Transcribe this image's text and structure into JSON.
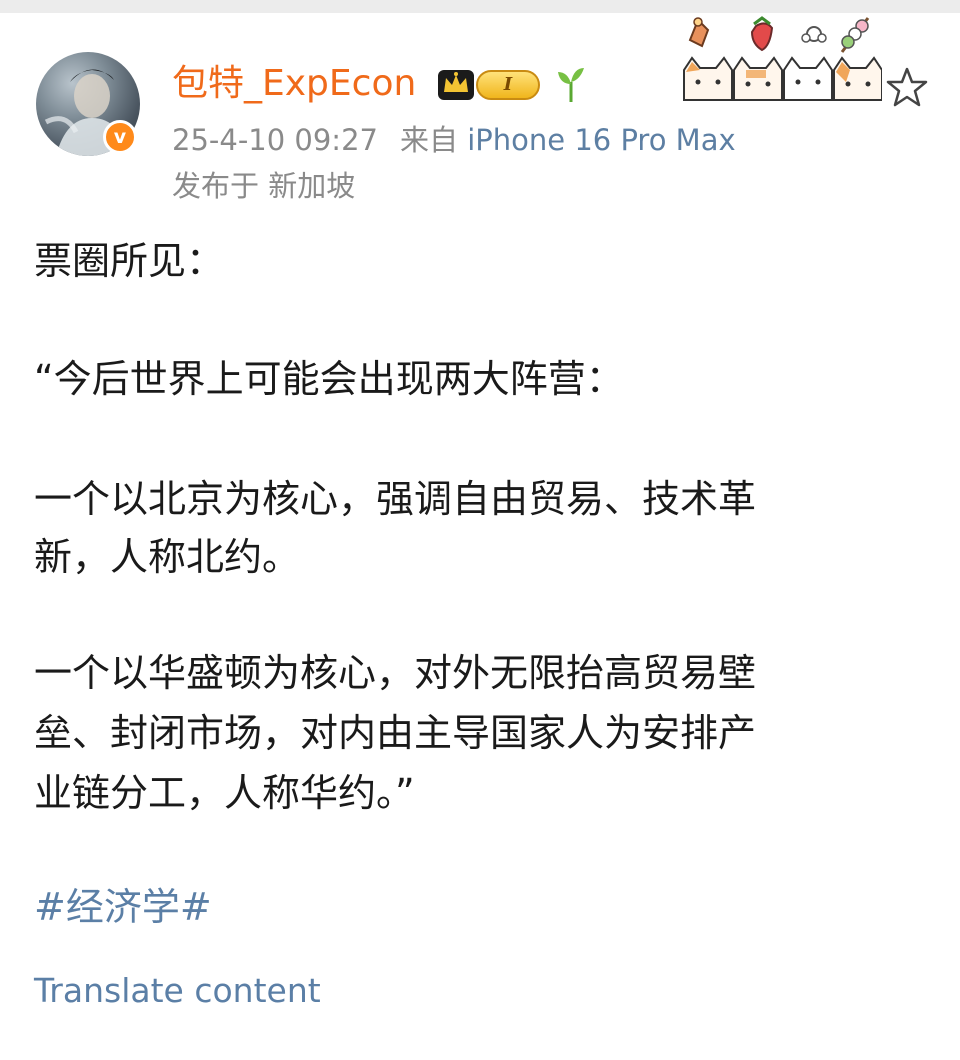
{
  "post": {
    "author": {
      "name": "包特_ExpEcon",
      "level_badge": "I",
      "verified_mark": "v"
    },
    "timestamp": "25-4-10 09:27",
    "source_prefix": "来自",
    "device": "iPhone 16 Pro Max",
    "location": "发布于 新加坡",
    "content": {
      "line1": "票圈所见：",
      "line2": "“今后世界上可能会出现两大阵营：",
      "line3": "一个以北京为核心，强调自由贸易、技术革",
      "line4": "新，人称北约。",
      "line5": "一个以华盛顿为核心，对外无限抬高贸易壁",
      "line6": "垒、封闭市场，对内由主导国家人为安排产",
      "line7": "业链分工，人称华约。”"
    },
    "hashtag": "#经济学#",
    "translate_label": "Translate content"
  },
  "icons": {
    "crown": "crown-icon",
    "sprout": "sprout-icon",
    "star": "star-icon",
    "sticker": "cat-sticker-decoration"
  },
  "colors": {
    "username": "#f06a1a",
    "verified_badge": "#ff8a1a",
    "link": "#5b7fa6",
    "meta_text": "#8a8a8a",
    "body_text": "#1a1a1a"
  }
}
